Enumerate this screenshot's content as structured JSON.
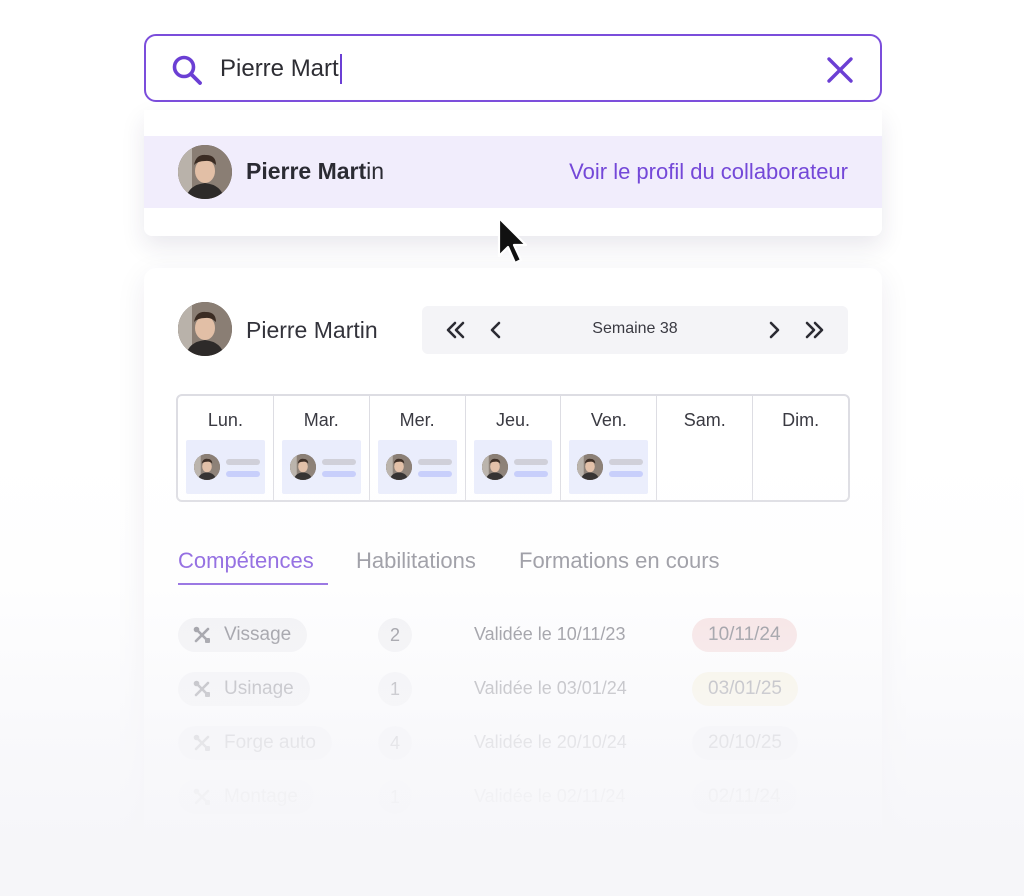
{
  "search": {
    "value": "Pierre Mart"
  },
  "suggestion": {
    "name_match": "Pierre Mart",
    "name_rest": "in",
    "action_label": "Voir le profil du collaborateur"
  },
  "profile": {
    "name": "Pierre Martin",
    "week_label": "Semaine 38",
    "days": [
      {
        "label": "Lun.",
        "has_shift": true
      },
      {
        "label": "Mar.",
        "has_shift": true
      },
      {
        "label": "Mer.",
        "has_shift": true
      },
      {
        "label": "Jeu.",
        "has_shift": true
      },
      {
        "label": "Ven.",
        "has_shift": true
      },
      {
        "label": "Sam.",
        "has_shift": false
      },
      {
        "label": "Dim.",
        "has_shift": false
      }
    ],
    "tabs": [
      {
        "label": "Compétences",
        "active": true
      },
      {
        "label": "Habilitations",
        "active": false
      },
      {
        "label": "Formations en cours",
        "active": false
      }
    ],
    "skills": [
      {
        "name": "Vissage",
        "level": "2",
        "validated": "Validée le 10/11/23",
        "expiry": "10/11/24",
        "expiry_color": "#f6dcdc"
      },
      {
        "name": "Usinage",
        "level": "1",
        "validated": "Validée le 03/01/24",
        "expiry": "03/01/25",
        "expiry_color": "#f8f1d8"
      },
      {
        "name": "Forge auto",
        "level": "4",
        "validated": "Validée le 20/10/24",
        "expiry": "20/10/25",
        "expiry_color": "#f0f0f3"
      },
      {
        "name": "Montage",
        "level": "1",
        "validated": "Validée le 02/11/24",
        "expiry": "02/11/24",
        "expiry_color": "#f0f0f3"
      }
    ]
  },
  "icons": {
    "search": "search-icon",
    "clear": "close-icon",
    "first": "double-chevron-left-icon",
    "prev": "chevron-left-icon",
    "next": "chevron-right-icon",
    "last": "double-chevron-right-icon",
    "skill": "tools-icon",
    "cursor": "mouse-pointer-icon"
  },
  "colors": {
    "accent": "#7b4ddb",
    "suggestion_bg": "#f1edfc",
    "shift_bg": "#eaedfc"
  }
}
